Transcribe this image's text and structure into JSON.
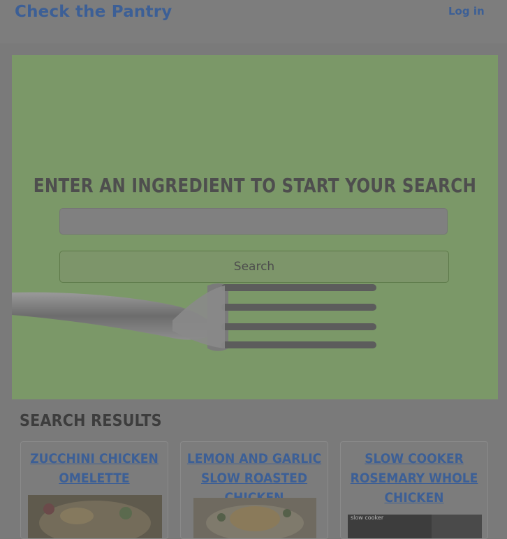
{
  "navbar": {
    "brand": "Check the Pantry",
    "login": "Log in"
  },
  "hero": {
    "title": "Enter an ingredient to start your search",
    "input_value": "",
    "button_label": "Search"
  },
  "results": {
    "title": "Search Results",
    "cards": [
      {
        "title": "Zucchini Chicken Omelette"
      },
      {
        "title": "Lemon and Garlic Slow Roasted Chicken"
      },
      {
        "title": "Slow Cooker Rosemary Whole Chicken",
        "image_caption": "slow cooker"
      }
    ]
  },
  "colors": {
    "brand": "#3c5f96",
    "hero_background": "#7b9868",
    "overlay_gray": "#7a7a7a"
  }
}
